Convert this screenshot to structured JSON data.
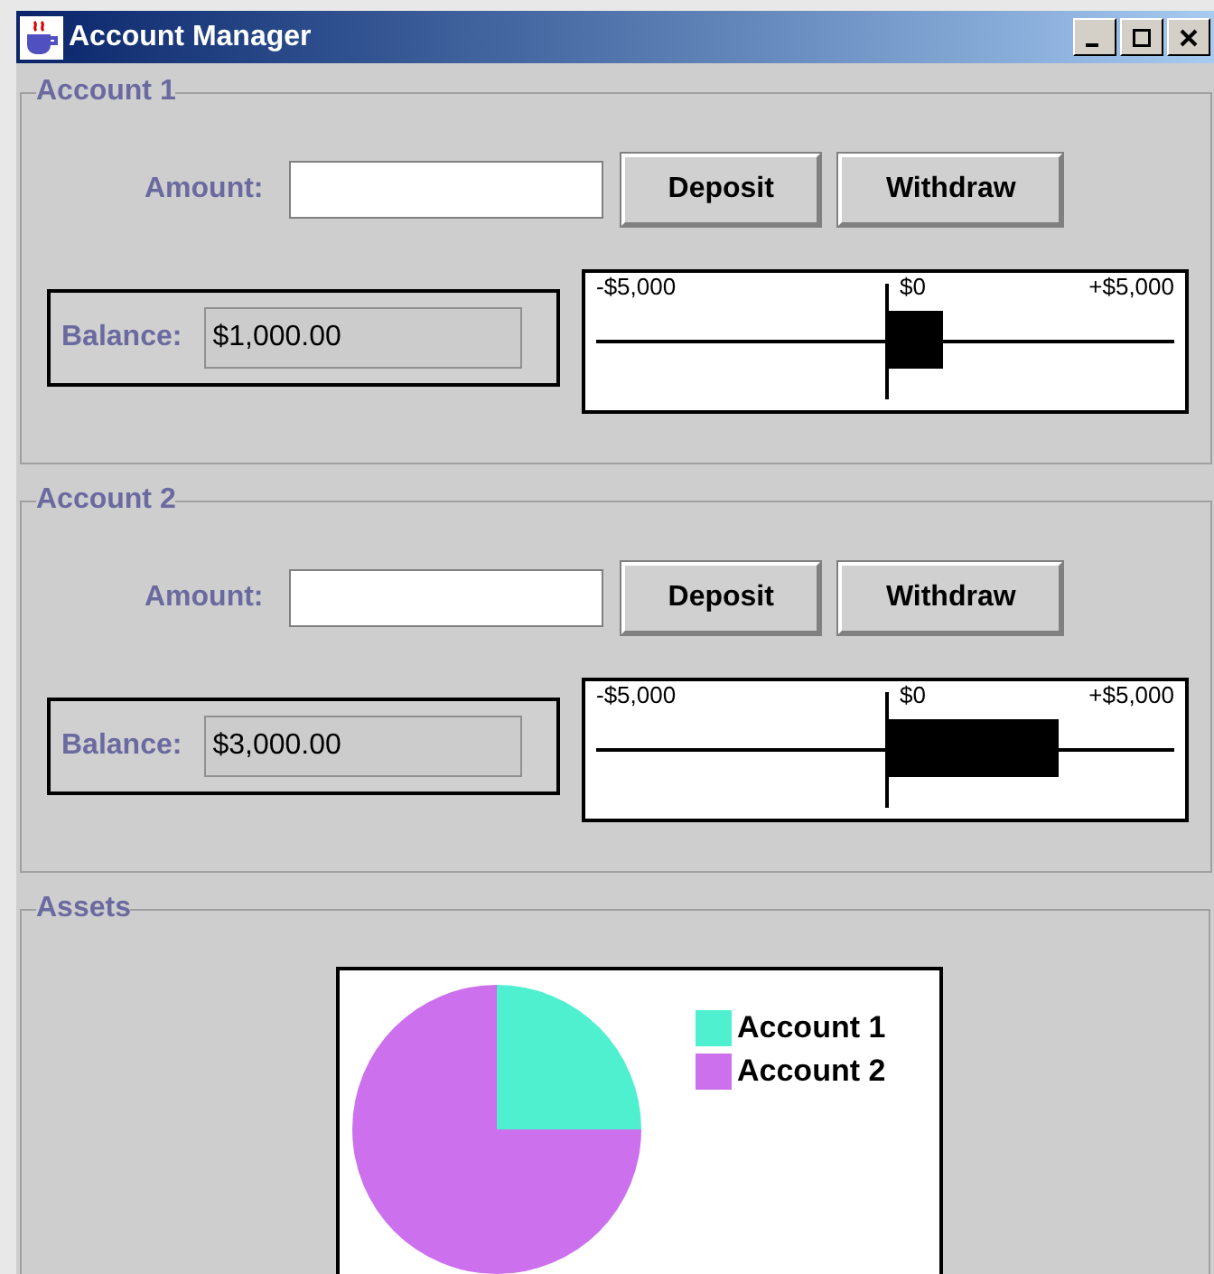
{
  "window": {
    "title": "Account Manager"
  },
  "accounts": [
    {
      "title": "Account 1",
      "amount_label": "Amount:",
      "deposit": "Deposit",
      "withdraw": "Withdraw",
      "balance_label": "Balance:",
      "balance": "$1,000.00",
      "meter": {
        "min_label": "-$5,000",
        "zero_label": "$0",
        "max_label": "+$5,000"
      }
    },
    {
      "title": "Account 2",
      "amount_label": "Amount:",
      "deposit": "Deposit",
      "withdraw": "Withdraw",
      "balance_label": "Balance:",
      "balance": "$3,000.00",
      "meter": {
        "min_label": "-$5,000",
        "zero_label": "$0",
        "max_label": "+$5,000"
      }
    }
  ],
  "assets": {
    "title": "Assets",
    "chart_data": {
      "type": "pie",
      "categories": [
        "Account 1",
        "Account 2"
      ],
      "series": [
        {
          "values": [
            25,
            75
          ]
        }
      ],
      "colors": [
        "#4ff0d0",
        "#cc70ee"
      ],
      "legend": "right"
    }
  }
}
